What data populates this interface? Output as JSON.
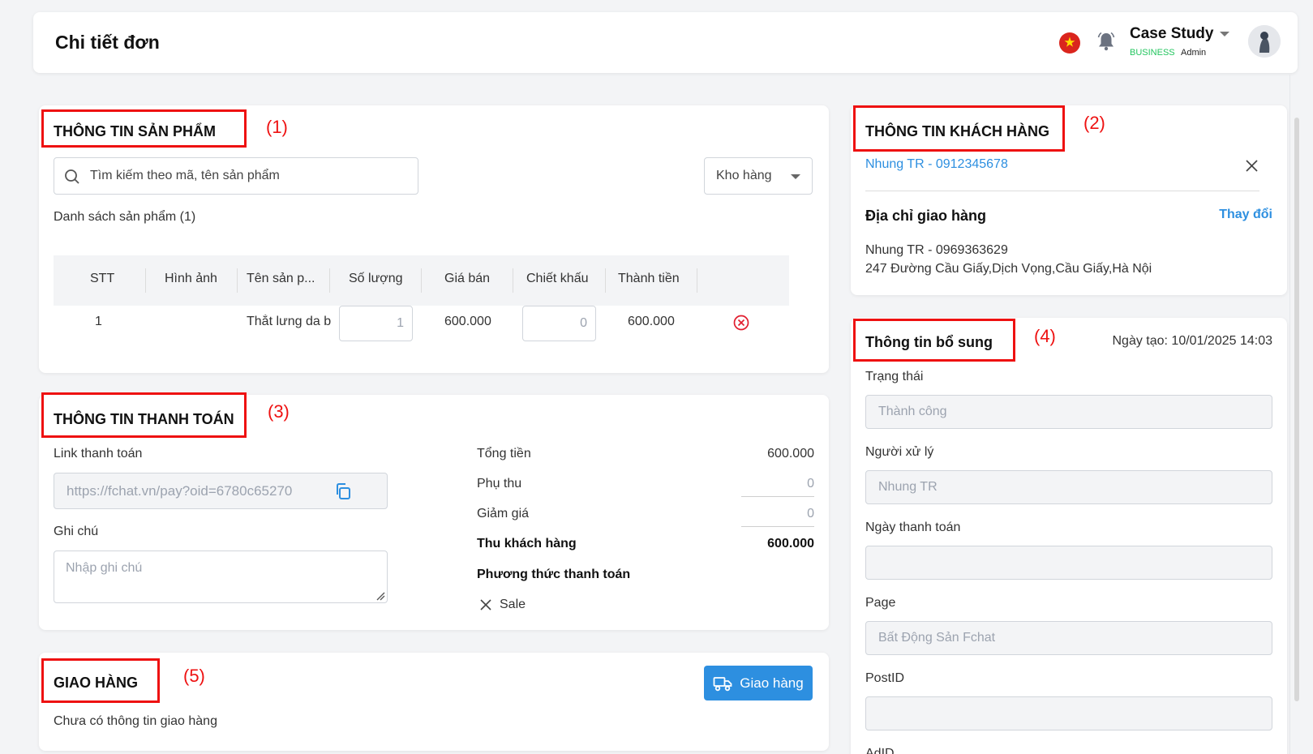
{
  "header": {
    "title": "Chi tiết đơn",
    "workspace_name": "Case Study",
    "workspace_plan": "BUSINESS",
    "workspace_role": "Admin"
  },
  "annotations": {
    "a1": "(1)",
    "a2": "(2)",
    "a3": "(3)",
    "a4": "(4)",
    "a5": "(5)"
  },
  "product": {
    "title": "THÔNG TIN SẢN PHẨM",
    "search_placeholder": "Tìm kiếm theo mã, tên sản phẩm",
    "warehouse_label": "Kho hàng",
    "list_label": "Danh sách sản phẩm (1)",
    "columns": [
      "STT",
      "Hình ảnh",
      "Tên sản p...",
      "Số lượng",
      "Giá bán",
      "Chiết khấu",
      "Thành tiền"
    ],
    "rows": [
      {
        "stt": "1",
        "name": "Thắt lưng da b",
        "qty": "1",
        "price": "600.000",
        "discount": "0",
        "total": "600.000"
      }
    ]
  },
  "payment": {
    "title": "THÔNG TIN THANH TOÁN",
    "link_label": "Link thanh toán",
    "link_value": "https://fchat.vn/pay?oid=6780c65270",
    "note_label": "Ghi chú",
    "note_placeholder": "Nhập ghi chú",
    "total_label": "Tổng tiền",
    "total_value": "600.000",
    "surcharge_label": "Phụ thu",
    "surcharge_value": "0",
    "discount_label": "Giảm giá",
    "discount_value": "0",
    "collect_label": "Thu khách hàng",
    "collect_value": "600.000",
    "method_label": "Phương thức thanh toán",
    "method_value": "Sale"
  },
  "shipping": {
    "title": "GIAO HÀNG",
    "button": "Giao hàng",
    "empty": "Chưa có thông tin giao hàng"
  },
  "customer": {
    "title": "THÔNG TIN KHÁCH HÀNG",
    "name_phone": "Nhung TR - 0912345678",
    "address_title": "Địa chỉ giao hàng",
    "change": "Thay đổi",
    "recipient": "Nhung TR - 0969363629",
    "address": "247 Đường Cầu Giấy,Dịch Vọng,Cầu Giấy,Hà Nội"
  },
  "extra": {
    "title": "Thông tin bổ sung",
    "created": "Ngày tạo: 10/01/2025 14:03",
    "status_label": "Trạng thái",
    "status_value": "Thành công",
    "handler_label": "Người xử lý",
    "handler_value": "Nhung TR",
    "paydate_label": "Ngày thanh toán",
    "paydate_value": "",
    "page_label": "Page",
    "page_value": "Bất Động Sản Fchat",
    "postid_label": "PostID",
    "postid_value": "",
    "adid_label": "AdID"
  },
  "colors": {
    "accent": "#2d8fe0",
    "annotation": "#ee1111",
    "link": "#2d8fe0",
    "success": "#22c55e"
  }
}
